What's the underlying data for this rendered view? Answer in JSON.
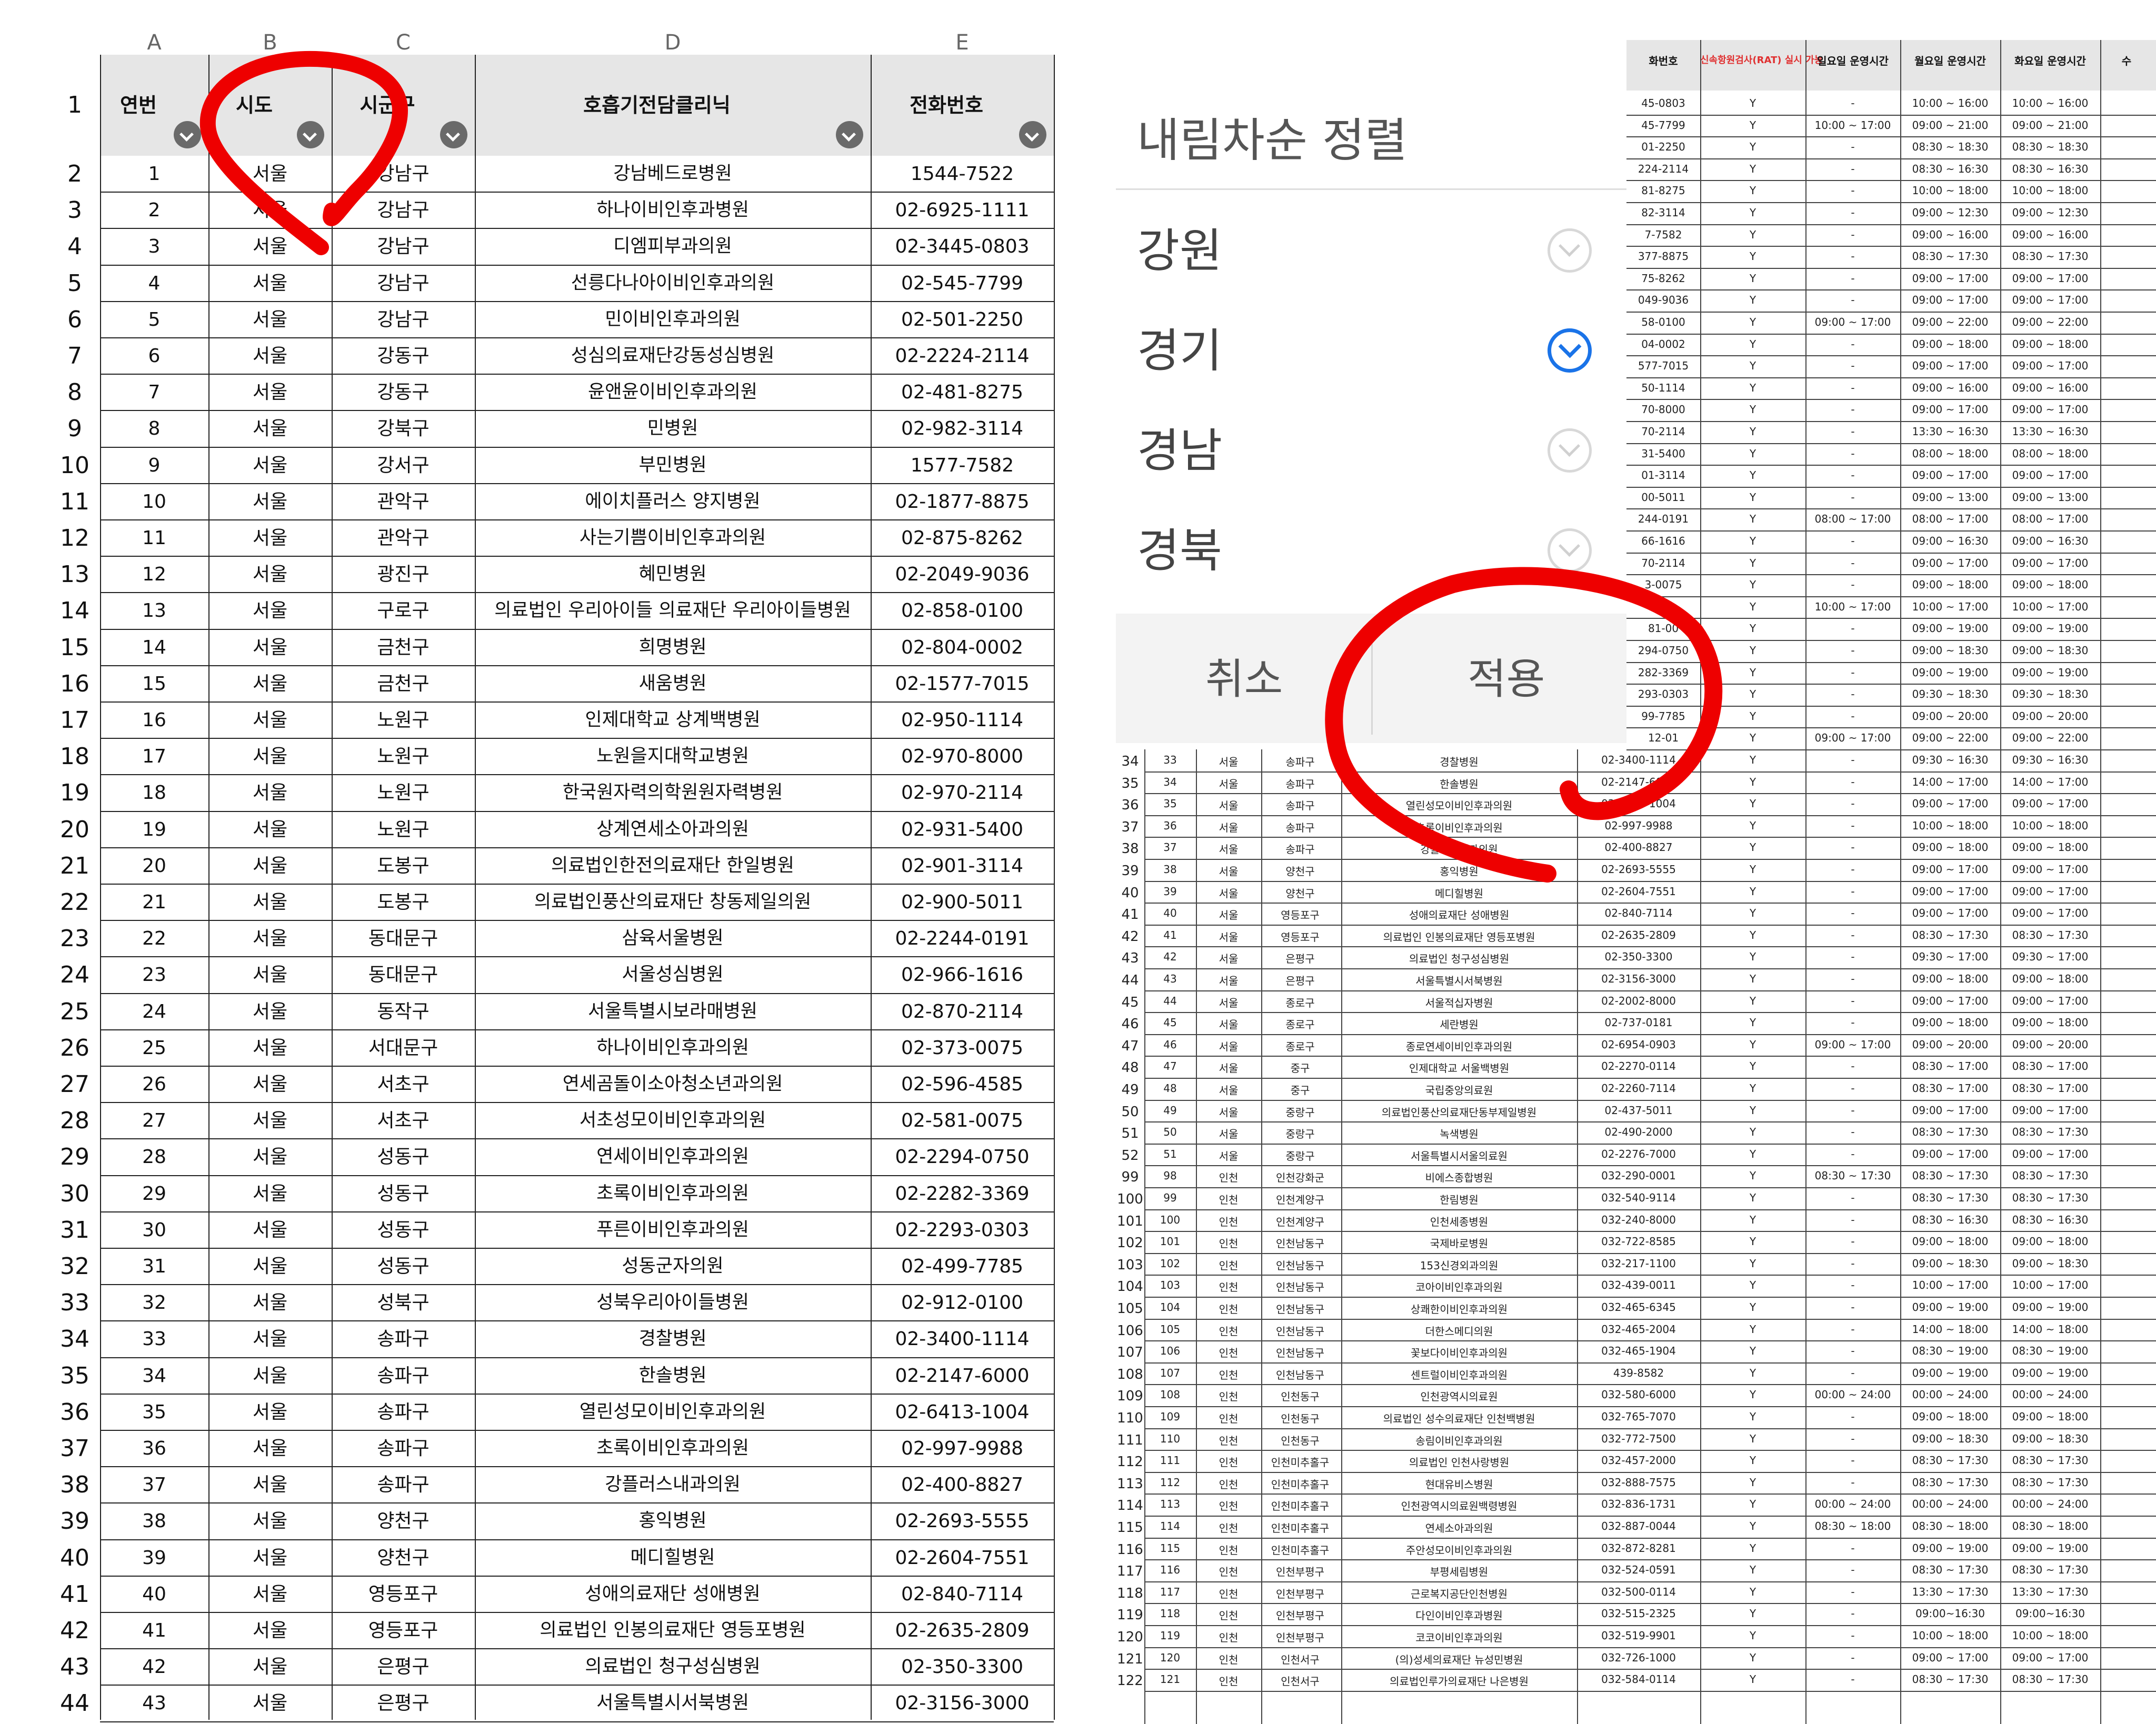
{
  "left_sheet": {
    "column_letters": [
      "A",
      "B",
      "C",
      "D",
      "E"
    ],
    "header_row_number": "1",
    "headers": [
      "연번",
      "시도",
      "시군구",
      "호흡기전담클리닉",
      "전화번호"
    ],
    "rows": [
      [
        "2",
        "1",
        "서울",
        "강남구",
        "강남베드로병원",
        "1544-7522"
      ],
      [
        "3",
        "2",
        "서울",
        "강남구",
        "하나이비인후과병원",
        "02-6925-1111"
      ],
      [
        "4",
        "3",
        "서울",
        "강남구",
        "디엠피부과의원",
        "02-3445-0803"
      ],
      [
        "5",
        "4",
        "서울",
        "강남구",
        "선릉다나아이비인후과의원",
        "02-545-7799"
      ],
      [
        "6",
        "5",
        "서울",
        "강남구",
        "민이비인후과의원",
        "02-501-2250"
      ],
      [
        "7",
        "6",
        "서울",
        "강동구",
        "성심의료재단강동성심병원",
        "02-2224-2114"
      ],
      [
        "8",
        "7",
        "서울",
        "강동구",
        "윤앤윤이비인후과의원",
        "02-481-8275"
      ],
      [
        "9",
        "8",
        "서울",
        "강북구",
        "민병원",
        "02-982-3114"
      ],
      [
        "10",
        "9",
        "서울",
        "강서구",
        "부민병원",
        "1577-7582"
      ],
      [
        "11",
        "10",
        "서울",
        "관악구",
        "에이치플러스 양지병원",
        "02-1877-8875"
      ],
      [
        "12",
        "11",
        "서울",
        "관악구",
        "사는기쁨이비인후과의원",
        "02-875-8262"
      ],
      [
        "13",
        "12",
        "서울",
        "광진구",
        "혜민병원",
        "02-2049-9036"
      ],
      [
        "14",
        "13",
        "서울",
        "구로구",
        "의료법인 우리아이들 의료재단 우리아이들병원",
        "02-858-0100"
      ],
      [
        "15",
        "14",
        "서울",
        "금천구",
        "희명병원",
        "02-804-0002"
      ],
      [
        "16",
        "15",
        "서울",
        "금천구",
        "새움병원",
        "02-1577-7015"
      ],
      [
        "17",
        "16",
        "서울",
        "노원구",
        "인제대학교 상계백병원",
        "02-950-1114"
      ],
      [
        "18",
        "17",
        "서울",
        "노원구",
        "노원을지대학교병원",
        "02-970-8000"
      ],
      [
        "19",
        "18",
        "서울",
        "노원구",
        "한국원자력의학원원자력병원",
        "02-970-2114"
      ],
      [
        "20",
        "19",
        "서울",
        "노원구",
        "상계연세소아과의원",
        "02-931-5400"
      ],
      [
        "21",
        "20",
        "서울",
        "도봉구",
        "의료법인한전의료재단 한일병원",
        "02-901-3114"
      ],
      [
        "22",
        "21",
        "서울",
        "도봉구",
        "의료법인풍산의료재단 창동제일의원",
        "02-900-5011"
      ],
      [
        "23",
        "22",
        "서울",
        "동대문구",
        "삼육서울병원",
        "02-2244-0191"
      ],
      [
        "24",
        "23",
        "서울",
        "동대문구",
        "서울성심병원",
        "02-966-1616"
      ],
      [
        "25",
        "24",
        "서울",
        "동작구",
        "서울특별시보라매병원",
        "02-870-2114"
      ],
      [
        "26",
        "25",
        "서울",
        "서대문구",
        "하나이비인후과의원",
        "02-373-0075"
      ],
      [
        "27",
        "26",
        "서울",
        "서초구",
        "연세곰돌이소아청소년과의원",
        "02-596-4585"
      ],
      [
        "28",
        "27",
        "서울",
        "서초구",
        "서초성모이비인후과의원",
        "02-581-0075"
      ],
      [
        "29",
        "28",
        "서울",
        "성동구",
        "연세이비인후과의원",
        "02-2294-0750"
      ],
      [
        "30",
        "29",
        "서울",
        "성동구",
        "초록이비인후과의원",
        "02-2282-3369"
      ],
      [
        "31",
        "30",
        "서울",
        "성동구",
        "푸른이비인후과의원",
        "02-2293-0303"
      ],
      [
        "32",
        "31",
        "서울",
        "성동구",
        "성동군자의원",
        "02-499-7785"
      ],
      [
        "33",
        "32",
        "서울",
        "성북구",
        "성북우리아이들병원",
        "02-912-0100"
      ],
      [
        "34",
        "33",
        "서울",
        "송파구",
        "경찰병원",
        "02-3400-1114"
      ],
      [
        "35",
        "34",
        "서울",
        "송파구",
        "한솔병원",
        "02-2147-6000"
      ],
      [
        "36",
        "35",
        "서울",
        "송파구",
        "열린성모이비인후과의원",
        "02-6413-1004"
      ],
      [
        "37",
        "36",
        "서울",
        "송파구",
        "초록이비인후과의원",
        "02-997-9988"
      ],
      [
        "38",
        "37",
        "서울",
        "송파구",
        "강플러스내과의원",
        "02-400-8827"
      ],
      [
        "39",
        "38",
        "서울",
        "양천구",
        "홍익병원",
        "02-2693-5555"
      ],
      [
        "40",
        "39",
        "서울",
        "양천구",
        "메디힐병원",
        "02-2604-7551"
      ],
      [
        "41",
        "40",
        "서울",
        "영등포구",
        "성애의료재단 성애병원",
        "02-840-7114"
      ],
      [
        "42",
        "41",
        "서울",
        "영등포구",
        "의료법인 인봉의료재단 영등포병원",
        "02-2635-2809"
      ],
      [
        "43",
        "42",
        "서울",
        "은평구",
        "의료법인 청구성심병원",
        "02-350-3300"
      ],
      [
        "44",
        "43",
        "서울",
        "은평구",
        "서울특별시서북병원",
        "02-3156-3000"
      ]
    ]
  },
  "sort_dialog": {
    "title": "내림차순 정렬",
    "options": [
      {
        "label": "강원",
        "checked": false
      },
      {
        "label": "경기",
        "checked": true
      },
      {
        "label": "경남",
        "checked": false
      },
      {
        "label": "경북",
        "checked": false
      }
    ],
    "cancel_label": "취소",
    "apply_label": "적용"
  },
  "right_sheet": {
    "headers": [
      "화번호",
      "신속항원검사(RAT) 실시 가능",
      "일요일 운영시간",
      "월요일 운영시간",
      "화요일 운영시간",
      "수"
    ],
    "top_rows": [
      [
        "45-0803",
        "Y",
        "-",
        "10:00 ~ 16:00",
        "10:00 ~ 16:00"
      ],
      [
        "45-7799",
        "Y",
        "10:00 ~ 17:00",
        "09:00 ~ 21:00",
        "09:00 ~ 21:00"
      ],
      [
        "01-2250",
        "Y",
        "-",
        "08:30 ~ 18:30",
        "08:30 ~ 18:30"
      ],
      [
        "224-2114",
        "Y",
        "-",
        "08:30 ~ 16:30",
        "08:30 ~ 16:30"
      ],
      [
        "81-8275",
        "Y",
        "-",
        "10:00 ~ 18:00",
        "10:00 ~ 18:00"
      ],
      [
        "82-3114",
        "Y",
        "-",
        "09:00 ~ 12:30",
        "09:00 ~ 12:30"
      ],
      [
        "7-7582",
        "Y",
        "-",
        "09:00 ~ 16:00",
        "09:00 ~ 16:00"
      ],
      [
        "377-8875",
        "Y",
        "-",
        "08:30 ~ 17:30",
        "08:30 ~ 17:30"
      ],
      [
        "75-8262",
        "Y",
        "-",
        "09:00 ~ 17:00",
        "09:00 ~ 17:00"
      ],
      [
        "049-9036",
        "Y",
        "-",
        "09:00 ~ 17:00",
        "09:00 ~ 17:00"
      ],
      [
        "58-0100",
        "Y",
        "09:00 ~ 17:00",
        "09:00 ~ 22:00",
        "09:00 ~ 22:00"
      ],
      [
        "04-0002",
        "Y",
        "-",
        "09:00 ~ 18:00",
        "09:00 ~ 18:00"
      ],
      [
        "577-7015",
        "Y",
        "-",
        "09:00 ~ 17:00",
        "09:00 ~ 17:00"
      ],
      [
        "50-1114",
        "Y",
        "-",
        "09:00 ~ 16:00",
        "09:00 ~ 16:00"
      ],
      [
        "70-8000",
        "Y",
        "-",
        "09:00 ~ 17:00",
        "09:00 ~ 17:00"
      ],
      [
        "70-2114",
        "Y",
        "-",
        "13:30 ~ 16:30",
        "13:30 ~ 16:30"
      ],
      [
        "31-5400",
        "Y",
        "-",
        "08:00 ~ 18:00",
        "08:00 ~ 18:00"
      ],
      [
        "01-3114",
        "Y",
        "-",
        "09:00 ~ 17:00",
        "09:00 ~ 17:00"
      ],
      [
        "00-5011",
        "Y",
        "-",
        "09:00 ~ 13:00",
        "09:00 ~ 13:00"
      ],
      [
        "244-0191",
        "Y",
        "08:00 ~ 17:00",
        "08:00 ~ 17:00",
        "08:00 ~ 17:00"
      ],
      [
        "66-1616",
        "Y",
        "-",
        "09:00 ~ 16:30",
        "09:00 ~ 16:30"
      ],
      [
        "70-2114",
        "Y",
        "-",
        "09:00 ~ 17:00",
        "09:00 ~ 17:00"
      ],
      [
        "3-0075",
        "Y",
        "-",
        "09:00 ~ 18:00",
        "09:00 ~ 18:00"
      ],
      [
        "",
        "Y",
        "10:00 ~ 17:00",
        "10:00 ~ 17:00",
        "10:00 ~ 17:00"
      ],
      [
        "81-00",
        "Y",
        "-",
        "09:00 ~ 19:00",
        "09:00 ~ 19:00"
      ],
      [
        "294-0750",
        "Y",
        "-",
        "09:00 ~ 18:30",
        "09:00 ~ 18:30"
      ],
      [
        "282-3369",
        "Y",
        "-",
        "09:00 ~ 19:00",
        "09:00 ~ 19:00"
      ],
      [
        "293-0303",
        "Y",
        "-",
        "09:30 ~ 18:30",
        "09:30 ~ 18:30"
      ],
      [
        "99-7785",
        "Y",
        "-",
        "09:00 ~ 20:00",
        "09:00 ~ 20:00"
      ],
      [
        "12-01",
        "Y",
        "09:00 ~ 17:00",
        "09:00 ~ 22:00",
        "09:00 ~ 22:00"
      ]
    ],
    "bottom_rows": [
      [
        "34",
        "33",
        "서울",
        "송파구",
        "경찰병원",
        "02-3400-1114",
        "Y",
        "-",
        "09:30 ~ 16:30",
        "09:30 ~ 16:30"
      ],
      [
        "35",
        "34",
        "서울",
        "송파구",
        "한솔병원",
        "02-2147-6000",
        "Y",
        "-",
        "14:00 ~ 17:00",
        "14:00 ~ 17:00"
      ],
      [
        "36",
        "35",
        "서울",
        "송파구",
        "열린성모이비인후과의원",
        "02-6413-1004",
        "Y",
        "-",
        "09:00 ~ 17:00",
        "09:00 ~ 17:00"
      ],
      [
        "37",
        "36",
        "서울",
        "송파구",
        "초록이비인후과의원",
        "02-997-9988",
        "Y",
        "-",
        "10:00 ~ 18:00",
        "10:00 ~ 18:00"
      ],
      [
        "38",
        "37",
        "서울",
        "송파구",
        "강플러스내과의원",
        "02-400-8827",
        "Y",
        "-",
        "09:00 ~ 18:00",
        "09:00 ~ 18:00"
      ],
      [
        "39",
        "38",
        "서울",
        "양천구",
        "홍익병원",
        "02-2693-5555",
        "Y",
        "-",
        "09:00 ~ 17:00",
        "09:00 ~ 17:00"
      ],
      [
        "40",
        "39",
        "서울",
        "양천구",
        "메디힐병원",
        "02-2604-7551",
        "Y",
        "-",
        "09:00 ~ 17:00",
        "09:00 ~ 17:00"
      ],
      [
        "41",
        "40",
        "서울",
        "영등포구",
        "성애의료재단 성애병원",
        "02-840-7114",
        "Y",
        "-",
        "09:00 ~ 17:00",
        "09:00 ~ 17:00"
      ],
      [
        "42",
        "41",
        "서울",
        "영등포구",
        "의료법인 인봉의료재단 영등포병원",
        "02-2635-2809",
        "Y",
        "-",
        "08:30 ~ 17:30",
        "08:30 ~ 17:30"
      ],
      [
        "43",
        "42",
        "서울",
        "은평구",
        "의료법인 청구성심병원",
        "02-350-3300",
        "Y",
        "-",
        "09:30 ~ 17:00",
        "09:30 ~ 17:00"
      ],
      [
        "44",
        "43",
        "서울",
        "은평구",
        "서울특별시서북병원",
        "02-3156-3000",
        "Y",
        "-",
        "09:00 ~ 18:00",
        "09:00 ~ 18:00"
      ],
      [
        "45",
        "44",
        "서울",
        "종로구",
        "서울적십자병원",
        "02-2002-8000",
        "Y",
        "-",
        "09:00 ~ 17:00",
        "09:00 ~ 17:00"
      ],
      [
        "46",
        "45",
        "서울",
        "종로구",
        "세란병원",
        "02-737-0181",
        "Y",
        "-",
        "09:00 ~ 18:00",
        "09:00 ~ 18:00"
      ],
      [
        "47",
        "46",
        "서울",
        "종로구",
        "종로연세이비인후과의원",
        "02-6954-0903",
        "Y",
        "09:00 ~ 17:00",
        "09:00 ~ 20:00",
        "09:00 ~ 20:00"
      ],
      [
        "48",
        "47",
        "서울",
        "중구",
        "인제대학교 서울백병원",
        "02-2270-0114",
        "Y",
        "-",
        "08:30 ~ 17:00",
        "08:30 ~ 17:00"
      ],
      [
        "49",
        "48",
        "서울",
        "중구",
        "국립중앙의료원",
        "02-2260-7114",
        "Y",
        "-",
        "08:30 ~ 17:00",
        "08:30 ~ 17:00"
      ],
      [
        "50",
        "49",
        "서울",
        "중랑구",
        "의료법인풍산의료재단동부제일병원",
        "02-437-5011",
        "Y",
        "-",
        "09:00 ~ 17:00",
        "09:00 ~ 17:00"
      ],
      [
        "51",
        "50",
        "서울",
        "중랑구",
        "녹색병원",
        "02-490-2000",
        "Y",
        "-",
        "08:30 ~ 17:30",
        "08:30 ~ 17:30"
      ],
      [
        "52",
        "51",
        "서울",
        "중랑구",
        "서울특별시서울의료원",
        "02-2276-7000",
        "Y",
        "-",
        "09:00 ~ 17:00",
        "09:00 ~ 17:00"
      ],
      [
        "99",
        "98",
        "인천",
        "인천강화군",
        "비에스종합병원",
        "032-290-0001",
        "Y",
        "08:30 ~ 17:30",
        "08:30 ~ 17:30",
        "08:30 ~ 17:30"
      ],
      [
        "100",
        "99",
        "인천",
        "인천계양구",
        "한림병원",
        "032-540-9114",
        "Y",
        "-",
        "08:30 ~ 17:30",
        "08:30 ~ 17:30"
      ],
      [
        "101",
        "100",
        "인천",
        "인천계양구",
        "인천세종병원",
        "032-240-8000",
        "Y",
        "-",
        "08:30 ~ 16:30",
        "08:30 ~ 16:30"
      ],
      [
        "102",
        "101",
        "인천",
        "인천남동구",
        "국제바로병원",
        "032-722-8585",
        "Y",
        "-",
        "09:00 ~ 18:00",
        "09:00 ~ 18:00"
      ],
      [
        "103",
        "102",
        "인천",
        "인천남동구",
        "153신경외과의원",
        "032-217-1100",
        "Y",
        "-",
        "09:00 ~ 18:30",
        "09:00 ~ 18:30"
      ],
      [
        "104",
        "103",
        "인천",
        "인천남동구",
        "코아이비인후과의원",
        "032-439-0011",
        "Y",
        "-",
        "10:00 ~ 17:00",
        "10:00 ~ 17:00"
      ],
      [
        "105",
        "104",
        "인천",
        "인천남동구",
        "상쾌한이비인후과의원",
        "032-465-6345",
        "Y",
        "-",
        "09:00 ~ 19:00",
        "09:00 ~ 19:00"
      ],
      [
        "106",
        "105",
        "인천",
        "인천남동구",
        "더한스메디의원",
        "032-465-2004",
        "Y",
        "-",
        "14:00 ~ 18:00",
        "14:00 ~ 18:00"
      ],
      [
        "107",
        "106",
        "인천",
        "인천남동구",
        "꽃보다이비인후과의원",
        "032-465-1904",
        "Y",
        "-",
        "08:30 ~ 19:00",
        "08:30 ~ 19:00"
      ],
      [
        "108",
        "107",
        "인천",
        "인천남동구",
        "센트럴이비인후과의원",
        "439-8582",
        "Y",
        "-",
        "09:00 ~ 19:00",
        "09:00 ~ 19:00"
      ],
      [
        "109",
        "108",
        "인천",
        "인천동구",
        "인천광역시의료원",
        "032-580-6000",
        "Y",
        "00:00 ~ 24:00",
        "00:00 ~ 24:00",
        "00:00 ~ 24:00"
      ],
      [
        "110",
        "109",
        "인천",
        "인천동구",
        "의료법인 성수의료재단 인천백병원",
        "032-765-7070",
        "Y",
        "-",
        "09:00 ~ 18:00",
        "09:00 ~ 18:00"
      ],
      [
        "111",
        "110",
        "인천",
        "인천동구",
        "송림이비인후과의원",
        "032-772-7500",
        "Y",
        "-",
        "09:00 ~ 18:30",
        "09:00 ~ 18:30"
      ],
      [
        "112",
        "111",
        "인천",
        "인천미추홀구",
        "의료법인 인천사랑병원",
        "032-457-2000",
        "Y",
        "-",
        "08:30 ~ 17:30",
        "08:30 ~ 17:30"
      ],
      [
        "113",
        "112",
        "인천",
        "인천미추홀구",
        "현대유비스병원",
        "032-888-7575",
        "Y",
        "-",
        "08:30 ~ 17:30",
        "08:30 ~ 17:30"
      ],
      [
        "114",
        "113",
        "인천",
        "인천미추홀구",
        "인천광역시의료원백령병원",
        "032-836-1731",
        "Y",
        "00:00 ~ 24:00",
        "00:00 ~ 24:00",
        "00:00 ~ 24:00"
      ],
      [
        "115",
        "114",
        "인천",
        "인천미추홀구",
        "연세소아과의원",
        "032-887-0044",
        "Y",
        "08:30 ~ 18:00",
        "08:30 ~ 18:00",
        "08:30 ~ 18:00"
      ],
      [
        "116",
        "115",
        "인천",
        "인천미추홀구",
        "주안성모이비인후과의원",
        "032-872-8281",
        "Y",
        "-",
        "09:00 ~ 19:00",
        "09:00 ~ 19:00"
      ],
      [
        "117",
        "116",
        "인천",
        "인천부평구",
        "부평세림병원",
        "032-524-0591",
        "Y",
        "-",
        "08:30 ~ 17:30",
        "08:30 ~ 17:30"
      ],
      [
        "118",
        "117",
        "인천",
        "인천부평구",
        "근로복지공단인천병원",
        "032-500-0114",
        "Y",
        "-",
        "13:30 ~ 17:30",
        "13:30 ~ 17:30"
      ],
      [
        "119",
        "118",
        "인천",
        "인천부평구",
        "다인이비인후과병원",
        "032-515-2325",
        "Y",
        "-",
        "09:00~16:30",
        "09:00~16:30"
      ],
      [
        "120",
        "119",
        "인천",
        "인천부평구",
        "코코이비인후과의원",
        "032-519-9901",
        "Y",
        "-",
        "10:00 ~ 18:00",
        "10:00 ~ 18:00"
      ],
      [
        "121",
        "120",
        "인천",
        "인천서구",
        "(의)성세의료재단 뉴성민병원",
        "032-726-1000",
        "Y",
        "-",
        "09:00 ~ 17:00",
        "09:00 ~ 17:00"
      ],
      [
        "122",
        "121",
        "인천",
        "인천서구",
        "의료법인루가의료재단 나은병원",
        "032-584-0114",
        "Y",
        "-",
        "08:30 ~ 17:30",
        "08:30 ~ 17:30"
      ]
    ]
  },
  "colors": {
    "accent": "#1a73e8",
    "annotation": "#ee0000",
    "header_bg": "#e6e6e6",
    "rat_header": "#e03030"
  }
}
